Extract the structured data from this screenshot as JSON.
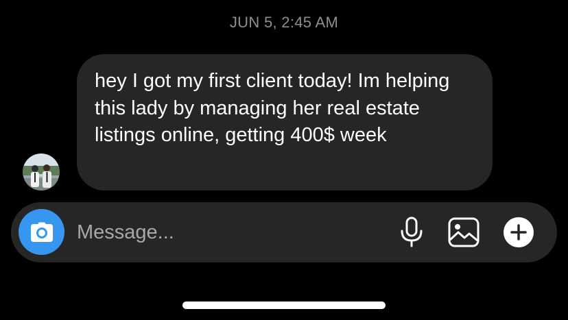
{
  "thread": {
    "timestamp": "JUN 5, 2:45 AM",
    "message": {
      "sender_avatar_icon": "avatar-photo",
      "text": "hey I got my first client today! Im helping this lady by managing her real estate listings online, getting 400$ week"
    }
  },
  "composer": {
    "placeholder": "Message...",
    "value": "",
    "icons": {
      "camera": "camera-icon",
      "mic": "microphone-icon",
      "gallery": "gallery-icon",
      "plus": "plus-icon"
    }
  },
  "colors": {
    "background": "#000000",
    "bubble": "#262626",
    "composer": "#262626",
    "camera_accent": "#3797f0",
    "timestamp": "#8e8e93",
    "text": "#ffffff"
  }
}
